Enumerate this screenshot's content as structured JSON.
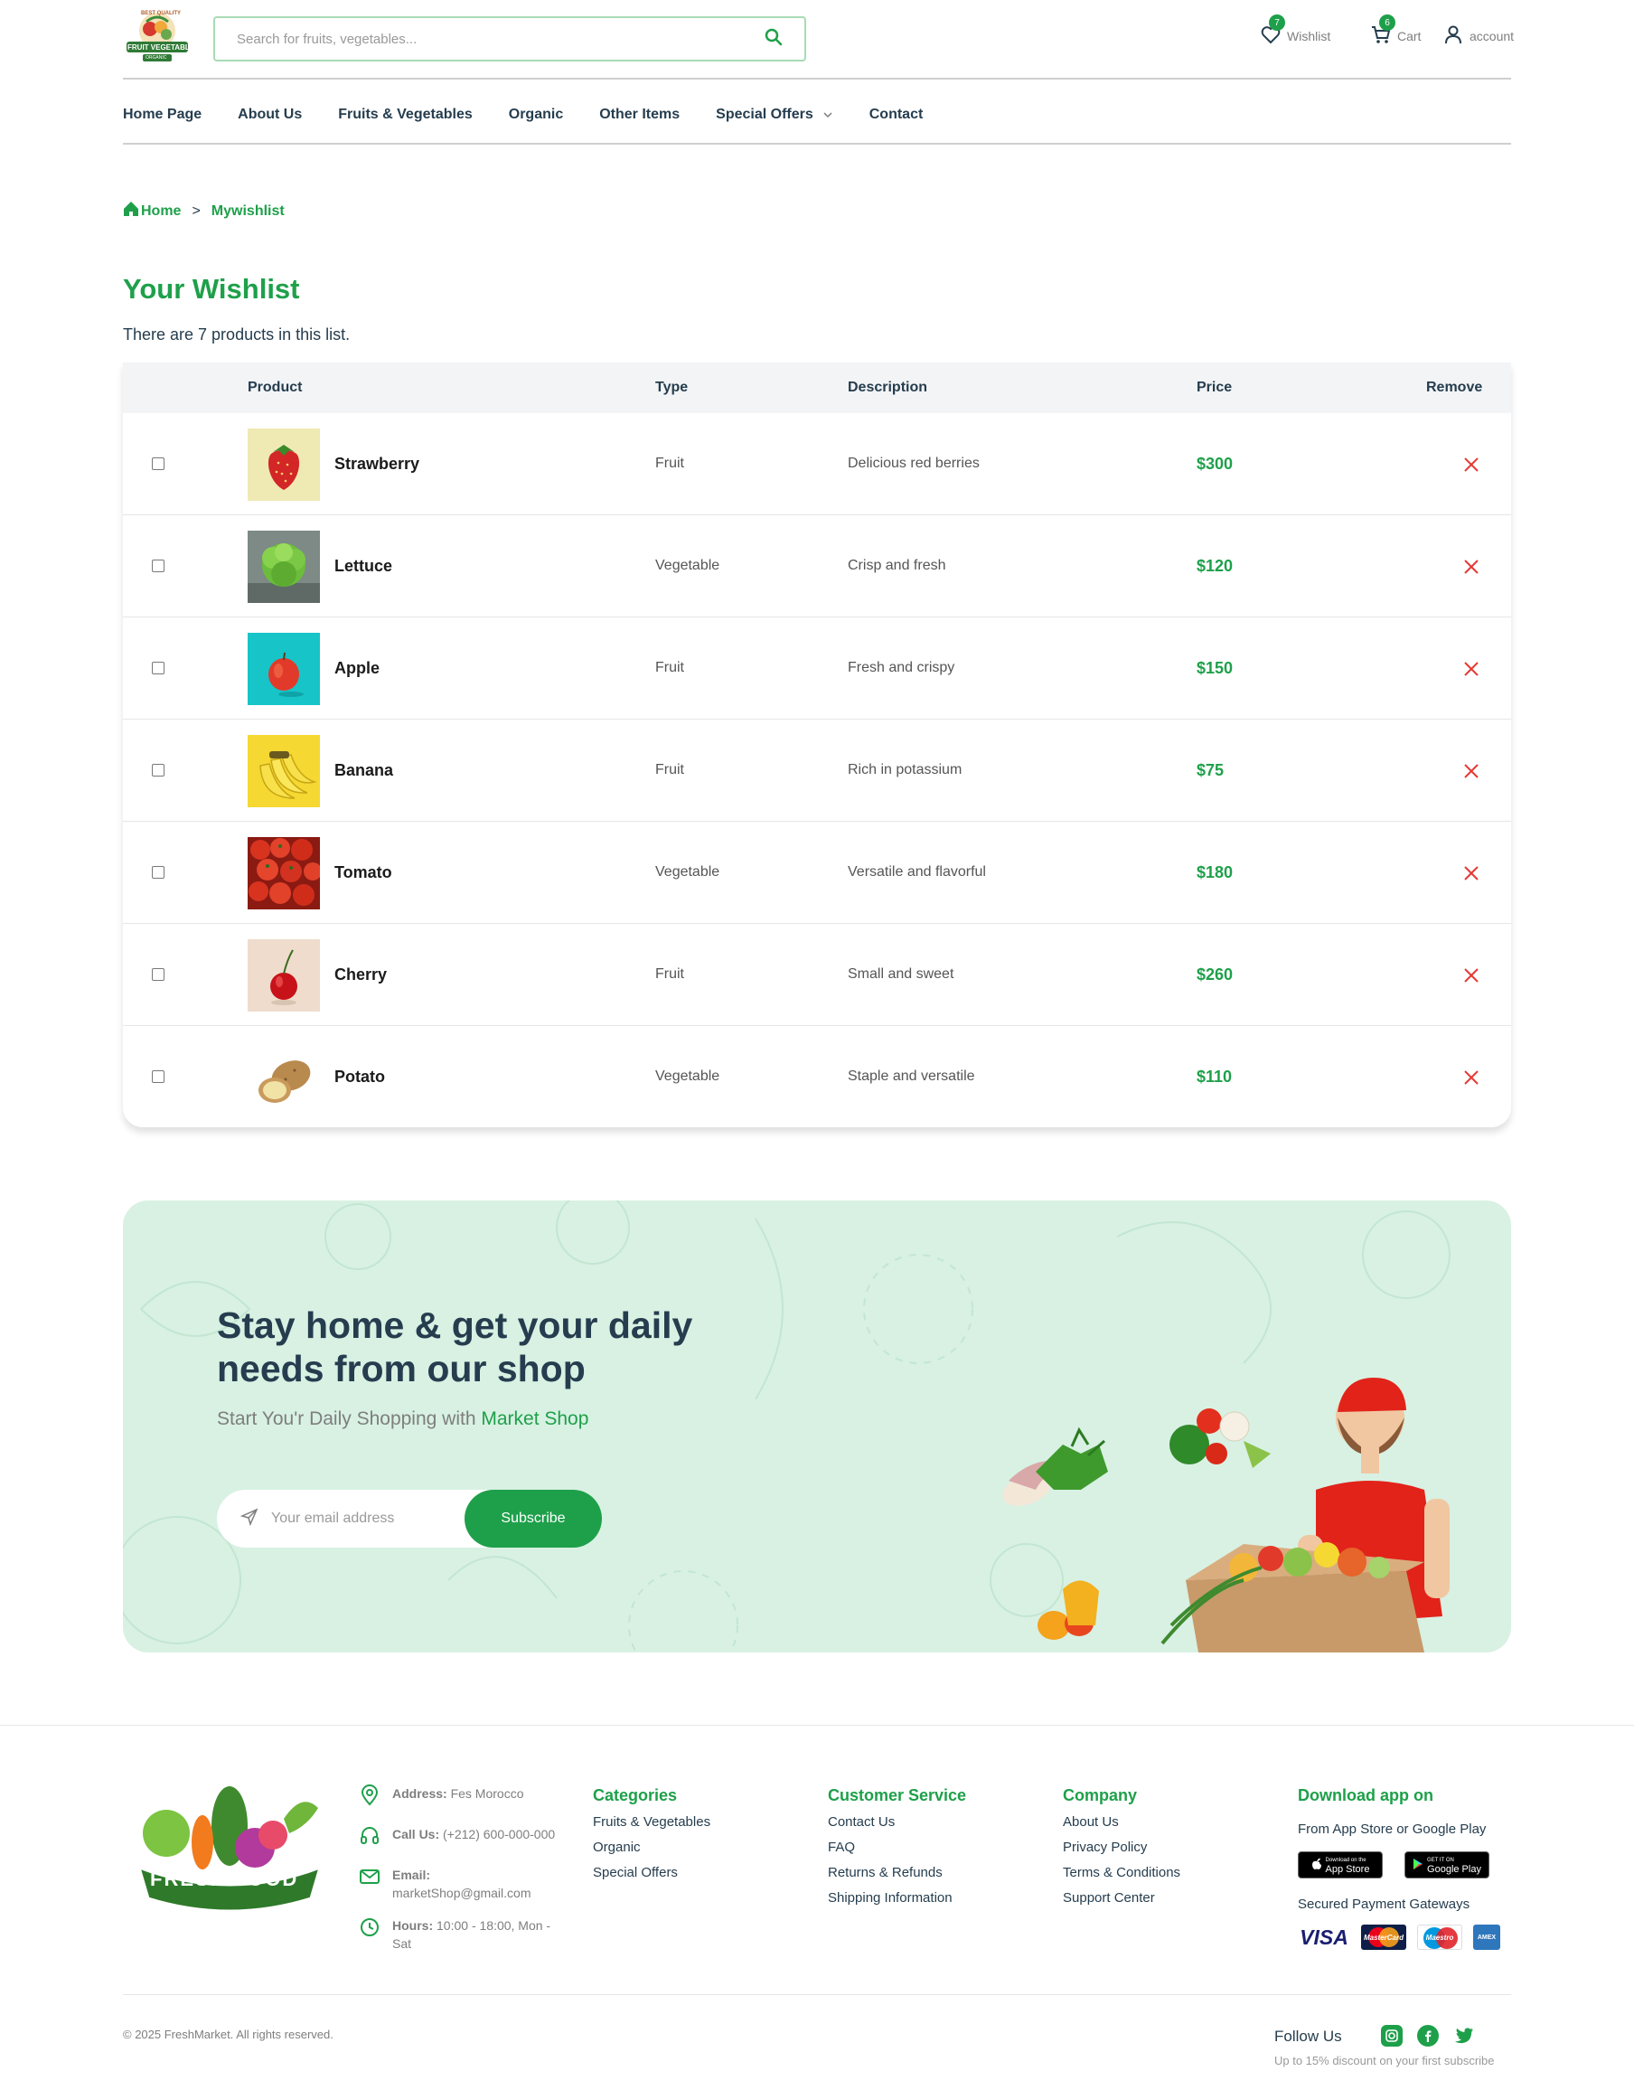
{
  "header": {
    "logo_text_top": "BEST QUALITY",
    "logo_text_main": "FRUIT VEGETABLE",
    "logo_text_bottom": "ORGANIC",
    "search_placeholder": "Search for fruits, vegetables...",
    "wishlist": {
      "label": "Wishlist",
      "count": "7"
    },
    "cart": {
      "label": "Cart",
      "count": "6"
    },
    "account_label": "account"
  },
  "nav": {
    "items": [
      "Home Page",
      "About Us",
      "Fruits & Vegetables",
      "Organic",
      "Other Items",
      "Special Offers",
      "Contact"
    ]
  },
  "breadcrumb": {
    "home": "Home",
    "separator": ">",
    "current": "Mywishlist"
  },
  "wishlist": {
    "title": "Your Wishlist",
    "subtitle": "There are 7 products in this list.",
    "columns": {
      "product": "Product",
      "type": "Type",
      "description": "Description",
      "price": "Price",
      "remove": "Remove"
    },
    "rows": [
      {
        "name": "Strawberry",
        "type": "Fruit",
        "description": "Delicious red berries",
        "price": "$300",
        "image": "strawberry-image"
      },
      {
        "name": "Lettuce",
        "type": "Vegetable",
        "description": "Crisp and fresh",
        "price": "$120",
        "image": "lettuce-image"
      },
      {
        "name": "Apple",
        "type": "Fruit",
        "description": "Fresh and crispy",
        "price": "$150",
        "image": "apple-image"
      },
      {
        "name": "Banana",
        "type": "Fruit",
        "description": "Rich in potassium",
        "price": "$75",
        "image": "banana-image"
      },
      {
        "name": "Tomato",
        "type": "Vegetable",
        "description": "Versatile and flavorful",
        "price": "$180",
        "image": "tomato-image"
      },
      {
        "name": "Cherry",
        "type": "Fruit",
        "description": "Small and sweet",
        "price": "$260",
        "image": "cherry-image"
      },
      {
        "name": "Potato",
        "type": "Vegetable",
        "description": "Staple and versatile",
        "price": "$110",
        "image": "potato-image"
      }
    ]
  },
  "newsletter": {
    "title": "Stay home & get your daily needs from our shop",
    "subtitle_prefix": "Start You'r Daily Shopping with ",
    "subtitle_accent": "Market Shop",
    "email_placeholder": "Your email address",
    "button": "Subscribe"
  },
  "footer": {
    "logo_text": "FRESH FOOD",
    "contact": {
      "address_label": "Address:",
      "address": "Fes Morocco",
      "call_label": "Call Us:",
      "call": "(+212) 600-000-000",
      "email_label": "Email:",
      "email": "marketShop@gmail.com",
      "hours_label": "Hours:",
      "hours": "10:00 - 18:00, Mon - Sat"
    },
    "categories": {
      "title": "Categories",
      "links": [
        "Fruits & Vegetables",
        "Organic",
        "Special Offers"
      ]
    },
    "customer_service": {
      "title": "Customer Service",
      "links": [
        "Contact Us",
        "FAQ",
        "Returns & Refunds",
        "Shipping Information"
      ]
    },
    "company": {
      "title": "Company",
      "links": [
        "About Us",
        "Privacy Policy",
        "Terms & Conditions",
        "Support Center"
      ]
    },
    "app": {
      "title": "Download app on",
      "subtitle": "From App Store or Google Play",
      "appstore_small": "Download on the",
      "appstore": "App Store",
      "googleplay_small": "GET IT ON",
      "googleplay": "Google Play",
      "payment_title": "Secured Payment Gateways",
      "payments": [
        "VISA",
        "MasterCard",
        "Maestro",
        "AMEX"
      ]
    },
    "copyright": "© 2025 FreshMarket. All rights reserved.",
    "follow_title": "Follow Us",
    "follow_subtitle": "Up to 15% discount on your first subscribe"
  },
  "colors": {
    "accent": "#1ea04a",
    "heading": "#253d4e",
    "banner_bg": "#d8f1e3",
    "remove": "#e53935"
  }
}
